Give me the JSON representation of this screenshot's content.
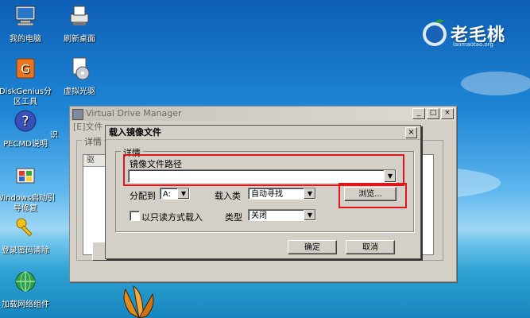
{
  "desktop": {
    "icons": [
      {
        "label": "我的电脑"
      },
      {
        "label": "刷新桌面"
      },
      {
        "label": "DiskGenius分区工具"
      },
      {
        "label": "虚拟光驱"
      },
      {
        "label": "PECMD说明"
      },
      {
        "label": "识"
      },
      {
        "label": "Windows启动引导修复"
      },
      {
        "label": "登录密码清除"
      },
      {
        "label": "加载网络组件"
      }
    ],
    "logo": {
      "text": "老毛桃",
      "url": "laomaotao.org"
    }
  },
  "back_window": {
    "title": "Virtual Drive Manager",
    "menu": "[E]文件",
    "detail_label": "详情",
    "column_header": "驱"
  },
  "dialog": {
    "title": "载入镜像文件",
    "group_label": "详情",
    "path_label": "镜像文件路径",
    "path_value": "",
    "browse_button": "浏览...",
    "assign_label": "分配到",
    "assign_value": "A:",
    "load_type_label": "载入类",
    "load_type_value": "自动寻找",
    "readonly_label": "以只读方式载入",
    "type_label": "类型",
    "type_value": "关闭",
    "ok_button": "确定",
    "cancel_button": "取消"
  },
  "colors": {
    "highlight": "#e0151b",
    "dialog_bg": "#d4d0c8"
  }
}
